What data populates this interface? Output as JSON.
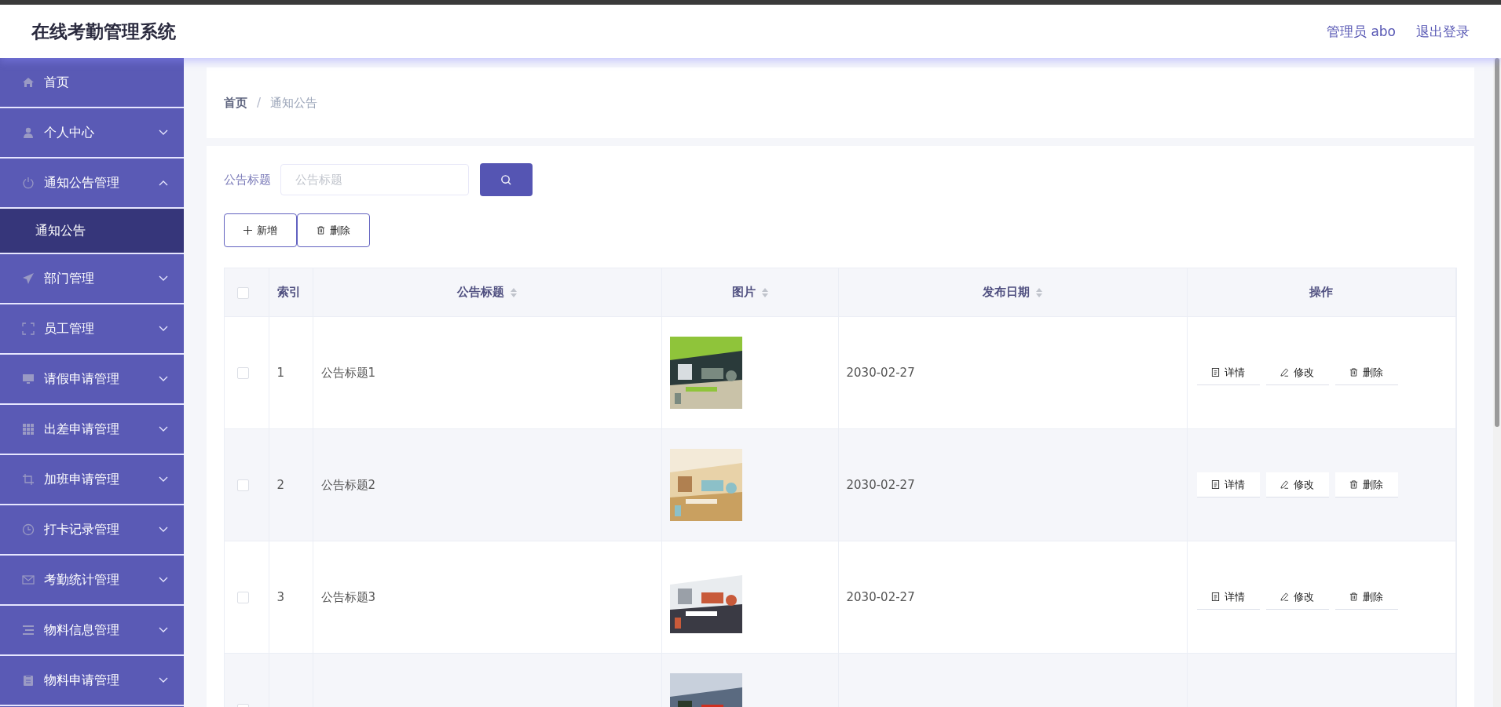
{
  "header": {
    "title": "在线考勤管理系统",
    "user": "管理员 abo",
    "logout": "退出登录"
  },
  "sidebar": {
    "items": [
      {
        "label": "首页",
        "kind": "link"
      },
      {
        "label": "个人中心",
        "kind": "submenu",
        "expanded": false
      },
      {
        "label": "通知公告管理",
        "kind": "submenu",
        "expanded": true,
        "children": [
          {
            "label": "通知公告",
            "selected": true
          }
        ]
      },
      {
        "label": "部门管理",
        "kind": "submenu",
        "expanded": false
      },
      {
        "label": "员工管理",
        "kind": "submenu",
        "expanded": false
      },
      {
        "label": "请假申请管理",
        "kind": "submenu",
        "expanded": false
      },
      {
        "label": "出差申请管理",
        "kind": "submenu",
        "expanded": false
      },
      {
        "label": "加班申请管理",
        "kind": "submenu",
        "expanded": false
      },
      {
        "label": "打卡记录管理",
        "kind": "submenu",
        "expanded": false
      },
      {
        "label": "考勤统计管理",
        "kind": "submenu",
        "expanded": false
      },
      {
        "label": "物料信息管理",
        "kind": "submenu",
        "expanded": false
      },
      {
        "label": "物料申请管理",
        "kind": "submenu",
        "expanded": false
      }
    ]
  },
  "breadcrumb": {
    "items": [
      "首页",
      "通知公告"
    ],
    "separator": "/"
  },
  "search": {
    "label": "公告标题",
    "placeholder": "公告标题"
  },
  "toolbar": [
    {
      "label": "新增",
      "kind": "add"
    },
    {
      "label": "删除",
      "kind": "delete"
    }
  ],
  "table": {
    "all_checked": false,
    "columns": [
      {
        "kind": "check"
      },
      {
        "label": "索引",
        "kind": "index",
        "sortable": false
      },
      {
        "label": "公告标题",
        "kind": "text",
        "sortable": true
      },
      {
        "label": "图片",
        "sortable": true
      },
      {
        "label": "发布日期",
        "kind": "text",
        "sortable": true
      },
      {
        "label": "操作",
        "kind": "actions",
        "sortable": false
      }
    ],
    "rows": [
      {
        "checked": false,
        "index": "1",
        "title": "公告标题1",
        "date": "2030-02-27",
        "actions": [
          {
            "label": "详情",
            "kind": "detail"
          },
          {
            "label": "修改",
            "kind": "edit"
          },
          {
            "label": "删除",
            "kind": "delete"
          }
        ]
      },
      {
        "checked": false,
        "index": "2",
        "title": "公告标题2",
        "date": "2030-02-27",
        "actions": [
          {
            "label": "详情",
            "kind": "detail"
          },
          {
            "label": "修改",
            "kind": "edit"
          },
          {
            "label": "删除",
            "kind": "delete"
          }
        ]
      },
      {
        "checked": false,
        "index": "3",
        "title": "公告标题3",
        "date": "2030-02-27",
        "actions": [
          {
            "label": "详情",
            "kind": "detail"
          },
          {
            "label": "修改",
            "kind": "edit"
          },
          {
            "label": "删除",
            "kind": "delete"
          }
        ]
      },
      {
        "checked": false
      }
    ]
  }
}
